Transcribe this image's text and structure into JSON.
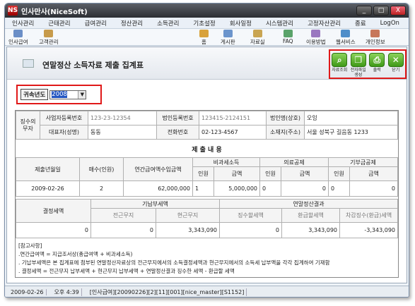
{
  "app": {
    "title": "인사만사(NiceSoft)",
    "logo": "NS"
  },
  "window_buttons": [
    "_",
    "□",
    "X"
  ],
  "menu": [
    "인사관리",
    "근태관리",
    "급여관리",
    "정산관리",
    "소득관리",
    "기초설정",
    "회사일정",
    "시스템관리",
    "고정자산관리",
    "종료",
    "LogOn"
  ],
  "toolbar": {
    "left": [
      {
        "label": "인사급여",
        "icon": "people-icon"
      },
      {
        "label": "고객관리",
        "icon": "customer-icon"
      }
    ],
    "right": [
      {
        "label": "홈",
        "icon": "home-icon"
      },
      {
        "label": "게시판",
        "icon": "board-icon"
      },
      {
        "label": "자료실",
        "icon": "archive-icon"
      },
      {
        "label": "FAQ",
        "icon": "faq-icon"
      },
      {
        "label": "이용방법",
        "icon": "help-icon"
      },
      {
        "label": "웹서비스",
        "icon": "web-icon"
      },
      {
        "label": "개인정보",
        "icon": "person-icon"
      }
    ]
  },
  "form": {
    "title": "연말정산 소득자료 제출 집계표"
  },
  "actions": [
    {
      "label": "자료조회",
      "icon": "search-icon"
    },
    {
      "label": "전자파일생성",
      "icon": "file-create-icon"
    },
    {
      "label": "출력",
      "icon": "print-icon"
    },
    {
      "label": "닫기",
      "icon": "close-icon"
    }
  ],
  "year": {
    "label": "귀속년도",
    "value": "2008"
  },
  "report": {
    "withholder": {
      "group": "징수의무자",
      "bizno_label": "사업자등록번호",
      "bizno": "123-23-12354",
      "corpno_label": "법인등록번호",
      "corpno": "123415-2124151",
      "corp_label": "법인명(상호)",
      "corp": "오잉",
      "rep_label": "대표자(성명)",
      "rep": "동동",
      "tel_label": "전화번호",
      "tel": "02-123-4567",
      "addr_label": "소재지(주소)",
      "addr": "서울 성북구 길음동 1233"
    },
    "section_title": "제 출 내 용",
    "h": {
      "date": "제출년월일",
      "count": "매수(인원)",
      "total": "연간급여액수입금액",
      "nontax": "비과세소득",
      "medical": "의료공제",
      "donation": "기부금공제",
      "persons": "인원",
      "amount": "금액"
    },
    "row": {
      "date": "2009-02-26",
      "count": "2",
      "total": "62,000,000",
      "nontax_p": "1",
      "nontax_a": "5,000,000",
      "med_p": "0",
      "med_a": "0",
      "don_p": "0",
      "don_a": "0"
    },
    "h2": {
      "decided": "결정세액",
      "paid": "기납부세액",
      "settle": "연말정산결과",
      "prev": "전근무지",
      "curr": "현근무지",
      "collect": "징수할세액",
      "refund": "환급할세액",
      "diff": "차감징수(환급)세액"
    },
    "row2": {
      "decided": "0",
      "prev": "0",
      "curr": "3,343,090",
      "collect": "0",
      "refund": "3,343,090",
      "diff": "-3,343,090"
    }
  },
  "notes": [
    "[참고사항]",
    ".연간급여액 = 지급조서상(총급여액 + 비과세소득)",
    ". 기납부세액은 본 집계표에 첨부된 연말정산자료상의 전근무지에서의 소득결정세액과 현근무지에서의 소득세 납부액을 각각 집계하여 기재함",
    ". 결정세액 = 전근무지 납부세액 + 현근무지 납부세액 + 연말정산결과 징수한 세액 - 환급할 세액"
  ],
  "status": [
    "2009-02-26",
    "오후 4:39",
    "[인사급여][20090226][2][11][001][nice_master][S1152]"
  ]
}
